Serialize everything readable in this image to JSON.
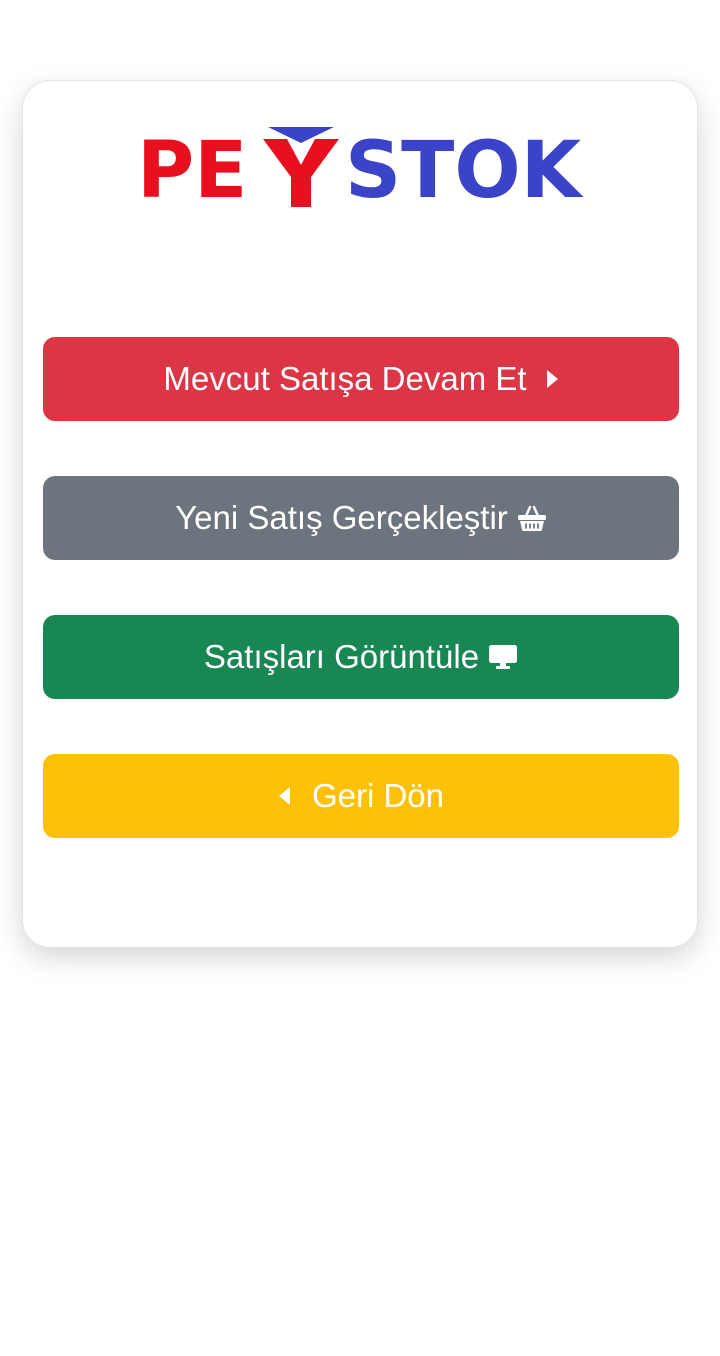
{
  "brand": {
    "logo_left": "PE",
    "logo_mark": "Y",
    "logo_right": "STOK",
    "color_red": "#e8101f",
    "color_blue": "#3b44c8"
  },
  "actions": {
    "continue_sale": {
      "label": "Mevcut Satışa Devam Et",
      "icon": "caret-right-icon",
      "color": "#dc3545"
    },
    "new_sale": {
      "label": "Yeni Satış Gerçekleştir",
      "icon": "basket-icon",
      "color": "#6c757d"
    },
    "view_sales": {
      "label": "Satışları Görüntüle",
      "icon": "desktop-icon",
      "color": "#198754"
    },
    "go_back": {
      "label": "Geri Dön",
      "icon": "caret-left-icon",
      "color": "#ffc107"
    }
  }
}
